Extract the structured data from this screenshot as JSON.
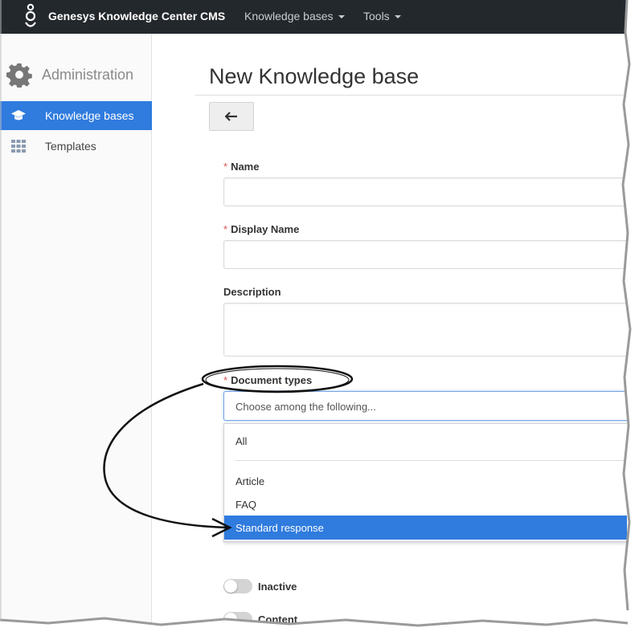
{
  "topbar": {
    "brand": "Genesys Knowledge Center CMS",
    "menus": [
      {
        "label": "Knowledge bases"
      },
      {
        "label": "Tools"
      }
    ]
  },
  "sidebar": {
    "section_title": "Administration",
    "items": [
      {
        "label": "Knowledge bases",
        "icon": "graduation-cap-icon",
        "active": true
      },
      {
        "label": "Templates",
        "icon": "grid-icon",
        "active": false
      }
    ]
  },
  "main": {
    "title": "New Knowledge base",
    "fields": {
      "name": {
        "label": "Name",
        "required": true,
        "value": ""
      },
      "display_name": {
        "label": "Display Name",
        "required": true,
        "value": ""
      },
      "description": {
        "label": "Description",
        "required": false,
        "value": ""
      },
      "document_types": {
        "label": "Document types",
        "required": true,
        "placeholder": "Choose among the following...",
        "options": [
          "All",
          "Article",
          "FAQ",
          "Standard response"
        ],
        "highlighted": "Standard response"
      }
    },
    "toggles": [
      {
        "label": "Inactive"
      },
      {
        "label": "Content"
      }
    ],
    "required_mark": "*"
  },
  "colors": {
    "navbar": "#23282d",
    "accent": "#2f7bde",
    "required": "#d9534f"
  }
}
